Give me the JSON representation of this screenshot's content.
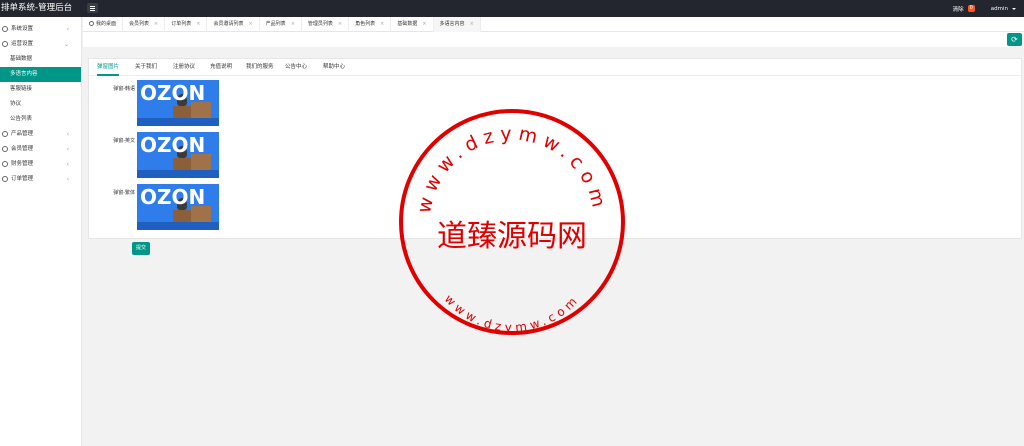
{
  "header": {
    "title": "排单系统-管理后台",
    "clear_label": "清除",
    "notice_count": "0",
    "user": "admin"
  },
  "sidebar": {
    "items": [
      {
        "label": "系统设置",
        "icon": "gear-icon",
        "has_arrow": true
      },
      {
        "label": "运营设置",
        "icon": "settings-icon",
        "has_arrow": true,
        "expanded": true
      },
      {
        "label": "基础数据",
        "sub": true
      },
      {
        "label": "多语言内容",
        "sub": true,
        "active": true
      },
      {
        "label": "客服链接",
        "sub": true
      },
      {
        "label": "协议",
        "sub": true
      },
      {
        "label": "公告列表",
        "sub": true
      },
      {
        "label": "产品管理",
        "icon": "product-icon",
        "has_arrow": true
      },
      {
        "label": "会员管理",
        "icon": "user-icon",
        "has_arrow": true
      },
      {
        "label": "财务管理",
        "icon": "finance-icon",
        "has_arrow": true
      },
      {
        "label": "订单管理",
        "icon": "order-icon",
        "has_arrow": true
      }
    ]
  },
  "tabs": [
    {
      "label": "我的桌面",
      "home": true
    },
    {
      "label": "会员列表"
    },
    {
      "label": "订单列表"
    },
    {
      "label": "会员邀请列表"
    },
    {
      "label": "产品列表"
    },
    {
      "label": "管理员列表"
    },
    {
      "label": "角色列表"
    },
    {
      "label": "基础数据"
    },
    {
      "label": "多语言内容",
      "active": true
    }
  ],
  "lang_tabs": [
    "弹窗图片",
    "关于我们",
    "注册协议",
    "充值说明",
    "我们的服务",
    "公告中心",
    "帮助中心"
  ],
  "rows": [
    {
      "label": "弹窗-韩语",
      "image_text": "OZON"
    },
    {
      "label": "弹窗-英文",
      "image_text": "OZON"
    },
    {
      "label": "弹窗-繁体",
      "image_text": "OZON"
    }
  ],
  "submit_label": "提交",
  "watermark": {
    "top_text": "www.dzymw.com",
    "center_text": "道臻源码网",
    "bottom_text": "www.dzymw.com",
    "color": "#e00000"
  },
  "colors": {
    "accent": "#009688",
    "header": "#23262e"
  }
}
